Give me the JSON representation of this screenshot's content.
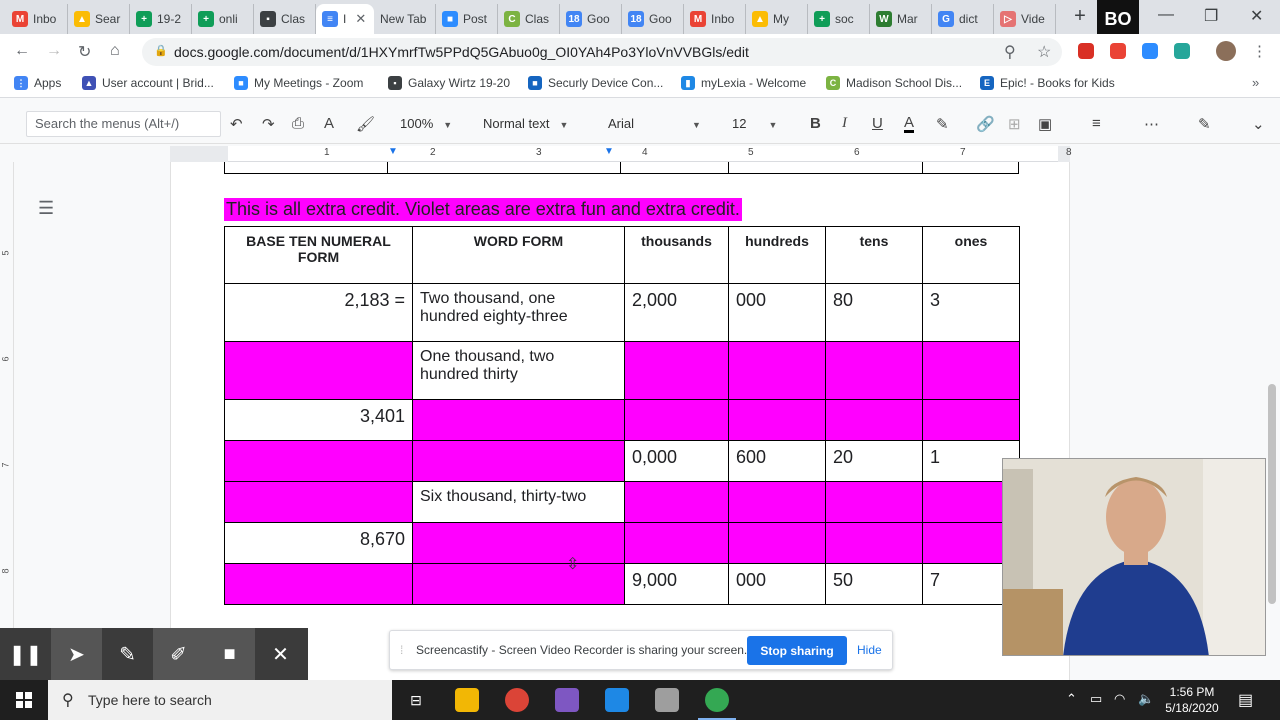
{
  "browser": {
    "tabs": [
      {
        "icon": "gmail-icon",
        "label": "Inbo",
        "color": "#ea4335",
        "glyph": "M"
      },
      {
        "icon": "drive-icon",
        "label": "Sear",
        "color": "#fbbc04",
        "glyph": "▲"
      },
      {
        "icon": "sheets-icon",
        "label": "19-2",
        "color": "#0f9d58",
        "glyph": "+"
      },
      {
        "icon": "sheets-icon",
        "label": "onli",
        "color": "#0f9d58",
        "glyph": "+"
      },
      {
        "icon": "classroom-icon",
        "label": "Clas",
        "color": "#3c4043",
        "glyph": "▪"
      },
      {
        "icon": "docs-icon",
        "label": "I",
        "color": "#4285f4",
        "glyph": "≡",
        "active": true
      },
      {
        "icon": "none",
        "label": "New Tab",
        "color": "",
        "glyph": ""
      },
      {
        "icon": "zoom-icon",
        "label": "Post",
        "color": "#2d8cff",
        "glyph": "■"
      },
      {
        "icon": "classlink-icon",
        "label": "Clas",
        "color": "#7cb342",
        "glyph": "C"
      },
      {
        "icon": "calendar-icon",
        "label": "Goo",
        "color": "#4285f4",
        "glyph": "18"
      },
      {
        "icon": "calendar-icon",
        "label": "Goo",
        "color": "#4285f4",
        "glyph": "18"
      },
      {
        "icon": "gmail-icon",
        "label": "Inbo",
        "color": "#ea4335",
        "glyph": "M"
      },
      {
        "icon": "drive-icon",
        "label": "My",
        "color": "#fbbc04",
        "glyph": "▲"
      },
      {
        "icon": "sheets-icon",
        "label": "soc",
        "color": "#0f9d58",
        "glyph": "+"
      },
      {
        "icon": "wixie-icon",
        "label": "Mar",
        "color": "#2e7d32",
        "glyph": "W"
      },
      {
        "icon": "google-icon",
        "label": "dict",
        "color": "#4285f4",
        "glyph": "G"
      },
      {
        "icon": "video-icon",
        "label": "Vide",
        "color": "#e57373",
        "glyph": "▷"
      }
    ],
    "new_tab_symbol": "+",
    "badge": "BO",
    "url": "docs.google.com/document/d/1HXYmrfTw5PPdQ5GAbuo0g_OI0YAh4Po3YloVnVVBGls/edit",
    "bookmarks": [
      {
        "icon": "apps-icon",
        "label": "Apps",
        "color": "#4285f4",
        "glyph": "⋮"
      },
      {
        "icon": "bridge-icon",
        "label": "User account | Brid...",
        "color": "#3f51b5",
        "glyph": "▲"
      },
      {
        "icon": "zoom-icon",
        "label": "My Meetings - Zoom",
        "color": "#2d8cff",
        "glyph": "■"
      },
      {
        "icon": "classroom-icon",
        "label": "Galaxy Wirtz 19-20",
        "color": "#3c4043",
        "glyph": "▪"
      },
      {
        "icon": "securly-icon",
        "label": "Securly Device Con...",
        "color": "#1565c0",
        "glyph": "■"
      },
      {
        "icon": "chart-icon",
        "label": "myLexia - Welcome",
        "color": "#1e88e5",
        "glyph": "▮"
      },
      {
        "icon": "classlink-icon",
        "label": "Madison School Dis...",
        "color": "#7cb342",
        "glyph": "C"
      },
      {
        "icon": "epic-icon",
        "label": "Epic! - Books for Kids",
        "color": "#1565c0",
        "glyph": "E"
      }
    ]
  },
  "docs_toolbar": {
    "search_placeholder": "Search the menus (Alt+/)",
    "zoom": "100%",
    "style": "Normal text",
    "font": "Arial",
    "size": "12"
  },
  "ruler": {
    "h_numbers": [
      "1",
      "2",
      "3",
      "4",
      "5",
      "6",
      "7",
      "8"
    ],
    "v_numbers": [
      "5",
      "6",
      "7",
      "8"
    ]
  },
  "document": {
    "extra_credit_text": "This is all extra credit.  Violet areas are extra fun and extra credit.",
    "table": {
      "headers": [
        "BASE TEN NUMERAL FORM",
        "WORD FORM",
        "thousands",
        "hundreds",
        "tens",
        "ones"
      ],
      "rows": [
        {
          "numeral": "2,183 =",
          "word": "Two thousand, one hundred eighty-three",
          "thousands": "2,000",
          "hundreds": "000",
          "tens": "80",
          "ones": "3",
          "fill": [
            false,
            false,
            false,
            false,
            false,
            false
          ]
        },
        {
          "numeral": "",
          "word": "One thousand, two hundred thirty",
          "thousands": "",
          "hundreds": "",
          "tens": "",
          "ones": "",
          "fill": [
            true,
            false,
            true,
            true,
            true,
            true
          ]
        },
        {
          "numeral": "3,401",
          "word": "",
          "thousands": "",
          "hundreds": "",
          "tens": "",
          "ones": "",
          "fill": [
            false,
            true,
            true,
            true,
            true,
            true
          ]
        },
        {
          "numeral": "",
          "word": "",
          "thousands": "0,000",
          "hundreds": "600",
          "tens": "20",
          "ones": "1",
          "fill": [
            true,
            true,
            false,
            false,
            false,
            false
          ]
        },
        {
          "numeral": "",
          "word": "Six thousand, thirty-two",
          "thousands": "",
          "hundreds": "",
          "tens": "",
          "ones": "",
          "fill": [
            true,
            false,
            true,
            true,
            true,
            true
          ]
        },
        {
          "numeral": "8,670",
          "word": "",
          "thousands": "",
          "hundreds": "",
          "tens": "",
          "ones": "",
          "fill": [
            false,
            true,
            true,
            true,
            true,
            true
          ]
        },
        {
          "numeral": "",
          "word": "",
          "thousands": "9,000",
          "hundreds": "000",
          "tens": "50",
          "ones": "7",
          "fill": [
            true,
            true,
            false,
            false,
            false,
            false
          ]
        }
      ]
    }
  },
  "screencastify": {
    "share_text": "Screencastify - Screen Video Recorder is sharing your screen.",
    "stop_label": "Stop sharing",
    "hide_label": "Hide"
  },
  "taskbar": {
    "search_placeholder": "Type here to search",
    "time": "1:56 PM",
    "date": "5/18/2020"
  },
  "colors": {
    "highlight": "#ff00ff",
    "docs_blue": "#4285f4",
    "stop_button": "#1a73e8"
  }
}
